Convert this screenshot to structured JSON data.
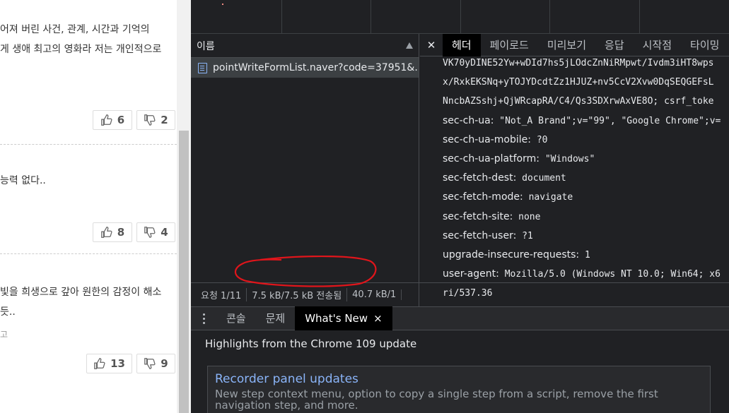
{
  "web": {
    "comments": [
      {
        "lines": [
          "어져 버린 사건, 관계, 시간과 기억의",
          "게 생애 최고의 영화라 저는 개인적으로"
        ],
        "likes": "6",
        "dislikes": "2"
      },
      {
        "lines": [
          "능력 없다.."
        ],
        "likes": "8",
        "dislikes": "4"
      },
      {
        "lines": [
          "빛을 희생으로 갚아 원한의 감정이 해소",
          "듯..",
          "고"
        ],
        "likes": "13",
        "dislikes": "9"
      }
    ]
  },
  "devtools": {
    "name_panel": {
      "header": "이름",
      "request": "pointWriteFormList.naver?code=37951&..."
    },
    "status": {
      "requests": "요청 1/11",
      "transferred": "7.5 kB/7.5 kB 전송됨",
      "resources": "40.7 kB/1"
    },
    "tabs": [
      "헤더",
      "페이로드",
      "미리보기",
      "응답",
      "시작점",
      "타이밍"
    ],
    "headers": [
      {
        "key": "",
        "value": "VK70yDINE52Yw+wDId7hs5jLOdcZnNiRMpwt/Ivdm3iHT8wps"
      },
      {
        "key": "",
        "value": "x/RxkEKSNq+yTOJYDcdtZz1HJUZ+nv5CcV2Xvw0DqSEQGEFsL"
      },
      {
        "key": "",
        "value": "NncbAZSshj+QjWRcapRA/C4/Qs3SDXrwAxVE8O; csrf_toke"
      },
      {
        "key": "sec-ch-ua:",
        "value": "\"Not_A Brand\";v=\"99\", \"Google Chrome\";v="
      },
      {
        "key": "sec-ch-ua-mobile:",
        "value": "?0"
      },
      {
        "key": "sec-ch-ua-platform:",
        "value": "\"Windows\""
      },
      {
        "key": "sec-fetch-dest:",
        "value": "document"
      },
      {
        "key": "sec-fetch-mode:",
        "value": "navigate"
      },
      {
        "key": "sec-fetch-site:",
        "value": "none"
      },
      {
        "key": "sec-fetch-user:",
        "value": "?1"
      },
      {
        "key": "upgrade-insecure-requests:",
        "value": "1"
      },
      {
        "key": "user-agent:",
        "value": "Mozilla/5.0 (Windows NT 10.0; Win64; x6"
      },
      {
        "key": "",
        "value": "ri/537.36"
      }
    ],
    "drawer": {
      "tabs": [
        "콘솔",
        "문제",
        "What's New"
      ],
      "close": "×",
      "highlights": "Highlights from the Chrome 109 update",
      "card_title": "Recorder panel updates",
      "card_body": "New step context menu, option to copy a single step from a script, remove the first navigation step, and more."
    },
    "annotation_color": "#e0151b"
  }
}
